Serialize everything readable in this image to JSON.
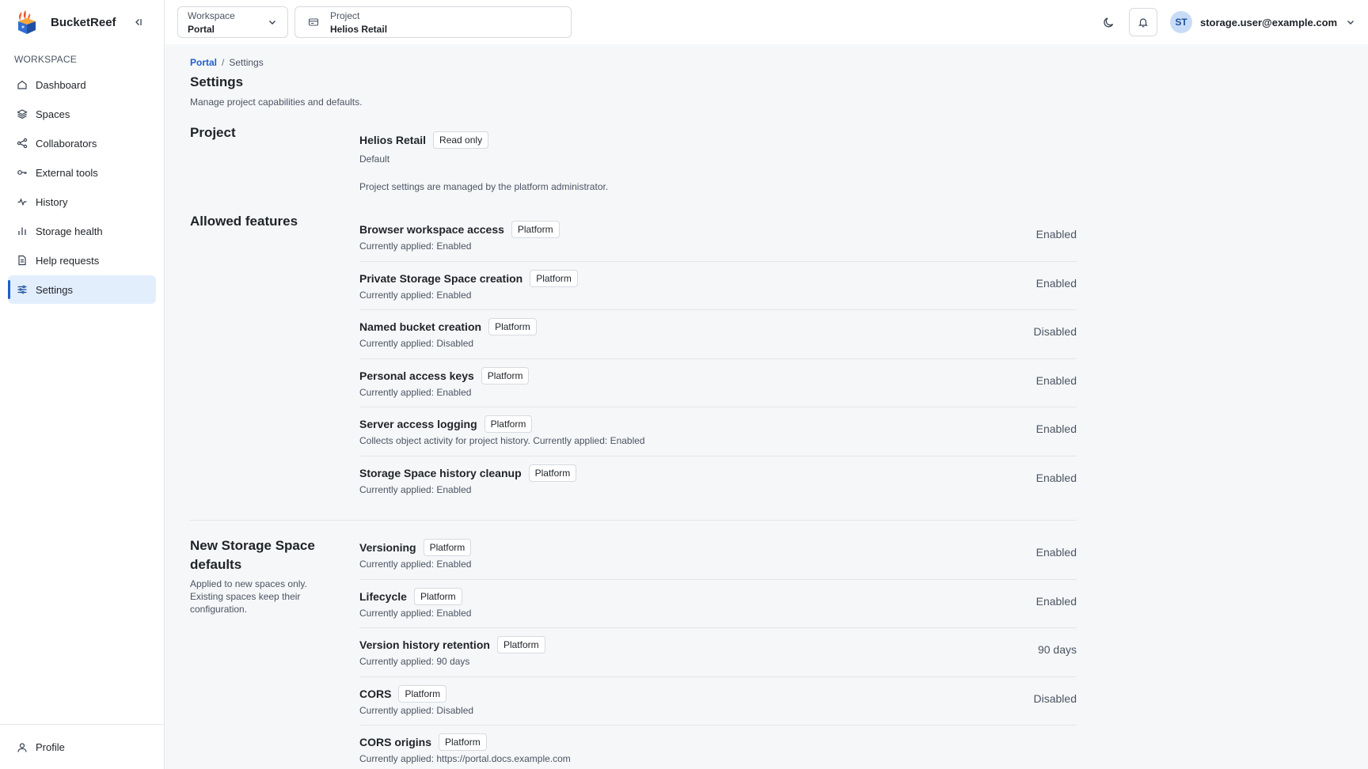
{
  "brand": {
    "name": "BucketReef"
  },
  "sidebar": {
    "section_label": "WORKSPACE",
    "items": [
      {
        "label": "Dashboard",
        "icon": "home-icon"
      },
      {
        "label": "Spaces",
        "icon": "layers-icon"
      },
      {
        "label": "Collaborators",
        "icon": "share-icon"
      },
      {
        "label": "External tools",
        "icon": "key-icon"
      },
      {
        "label": "History",
        "icon": "activity-icon"
      },
      {
        "label": "Storage health",
        "icon": "bar-chart-icon"
      },
      {
        "label": "Help requests",
        "icon": "file-icon"
      },
      {
        "label": "Settings",
        "icon": "sliders-icon",
        "active": true
      }
    ],
    "footer": {
      "label": "Profile",
      "icon": "user-icon"
    }
  },
  "topbar": {
    "workspace": {
      "label": "Workspace",
      "value": "Portal"
    },
    "project": {
      "label": "Project",
      "value": "Helios Retail"
    },
    "user": {
      "initials": "ST",
      "email": "storage.user@example.com"
    }
  },
  "breadcrumb": {
    "root": "Portal",
    "separator": "/",
    "current": "Settings"
  },
  "page": {
    "title": "Settings",
    "subtitle": "Manage project capabilities and defaults."
  },
  "project_section": {
    "title": "Project",
    "name": "Helios Retail",
    "badge": "Read only",
    "default_label": "Default",
    "note": "Project settings are managed by the platform administrator."
  },
  "allowed_features": {
    "title": "Allowed features",
    "items": [
      {
        "name": "Browser workspace access",
        "badge": "Platform",
        "sub": "Currently applied: Enabled",
        "value": "Enabled"
      },
      {
        "name": "Private Storage Space creation",
        "badge": "Platform",
        "sub": "Currently applied: Enabled",
        "value": "Enabled"
      },
      {
        "name": "Named bucket creation",
        "badge": "Platform",
        "sub": "Currently applied: Disabled",
        "value": "Disabled"
      },
      {
        "name": "Personal access keys",
        "badge": "Platform",
        "sub": "Currently applied: Enabled",
        "value": "Enabled"
      },
      {
        "name": "Server access logging",
        "badge": "Platform",
        "sub": "Collects object activity for project history. Currently applied: Enabled",
        "value": "Enabled"
      },
      {
        "name": "Storage Space history cleanup",
        "badge": "Platform",
        "sub": "Currently applied: Enabled",
        "value": "Enabled"
      }
    ]
  },
  "new_space_defaults": {
    "title_line1": "New Storage Space",
    "title_line2": "defaults",
    "description": "Applied to new spaces only. Existing spaces keep their configuration.",
    "items": [
      {
        "name": "Versioning",
        "badge": "Platform",
        "sub": "Currently applied: Enabled",
        "value": "Enabled"
      },
      {
        "name": "Lifecycle",
        "badge": "Platform",
        "sub": "Currently applied: Enabled",
        "value": "Enabled"
      },
      {
        "name": "Version history retention",
        "badge": "Platform",
        "sub": "Currently applied: 90 days",
        "value": "90 days"
      },
      {
        "name": "CORS",
        "badge": "Platform",
        "sub": "Currently applied: Disabled",
        "value": "Disabled"
      },
      {
        "name": "CORS origins",
        "badge": "Platform",
        "sub": "Currently applied: https://portal.docs.example.com",
        "value": ""
      }
    ]
  }
}
